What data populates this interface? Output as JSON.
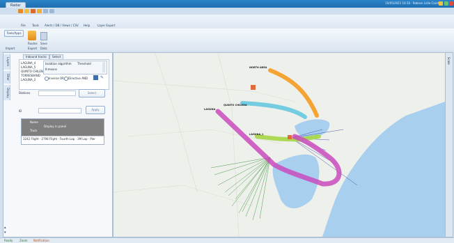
{
  "window": {
    "tab_title": "Radar",
    "top_info": "10/05/2021 16:16 · Robson Lidia Caird"
  },
  "menu": [
    "File",
    "Tools",
    "Alerts / DB / Views / CSV",
    "Help",
    "Layer Export"
  ],
  "ribbon": {
    "left_button": "Tools/Apps",
    "group_label_1": "Import",
    "group_label_2": "Export",
    "group_label_3": "Data",
    "icon_label_1": "Routes",
    "icon_label_2": "Save"
  },
  "vertical_tabs": [
    "Layers",
    "Filter",
    "Display"
  ],
  "panel": {
    "tabs": [
      "Inbound tracks",
      "Select"
    ],
    "list_items": [
      "LAGUNA_4",
      "LAGUNA_5",
      "QUINTO CHILENA",
      "TORRESBAND",
      "LAGUNA_2"
    ],
    "algo_header": "Isolation algorithm",
    "threshold_header": "Threshold",
    "algo_value": "K-means",
    "inverse_a": "Inverse OR",
    "inverse_b": "Directive AND",
    "stations_label": "Stations",
    "id_label": "ID",
    "btn_1": "Select",
    "btn_2": "Apply",
    "grid_header_1": "Name",
    "grid_header_2": "Track",
    "grid_header_3": "Display in panel",
    "grid_row": "3242 Flight · 2798 Flight · Fourth Lap · 3M Lap · Pier"
  },
  "map": {
    "labels": [
      "NORTH AREA",
      "QUINTO CHILENA",
      "LAGUNA",
      "LAGUNA_1"
    ],
    "right_tab": "Scale"
  },
  "status": {
    "items": [
      "Ready",
      "Zoom",
      "Notification"
    ]
  },
  "colors": {
    "accent": "#2c84c8",
    "orange_route": "#f59a1e",
    "cyan_route": "#5ec6de",
    "magenta_route": "#c94bbd",
    "green_route": "#a6d646",
    "tracks": "#2d8b2d",
    "water": "#a9cfef",
    "land": "#eef0eb"
  }
}
